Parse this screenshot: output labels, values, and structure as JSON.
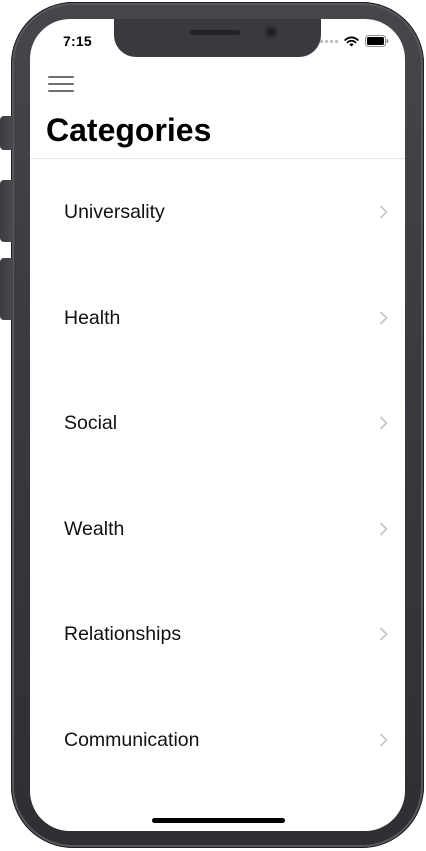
{
  "status_bar": {
    "time": "7:15",
    "icons": [
      "cellular-dots-icon",
      "wifi-icon",
      "battery-icon"
    ]
  },
  "nav": {
    "menu_icon": "hamburger-menu-icon"
  },
  "page": {
    "title": "Categories"
  },
  "categories": [
    {
      "label": "Universality"
    },
    {
      "label": "Health"
    },
    {
      "label": "Social"
    },
    {
      "label": "Wealth"
    },
    {
      "label": "Relationships"
    },
    {
      "label": "Communication"
    }
  ],
  "colors": {
    "device_frame": "#3a393e",
    "chevron": "#c7c7cc",
    "divider": "#e5e5ea",
    "menu_icon": "#6e6e73"
  }
}
